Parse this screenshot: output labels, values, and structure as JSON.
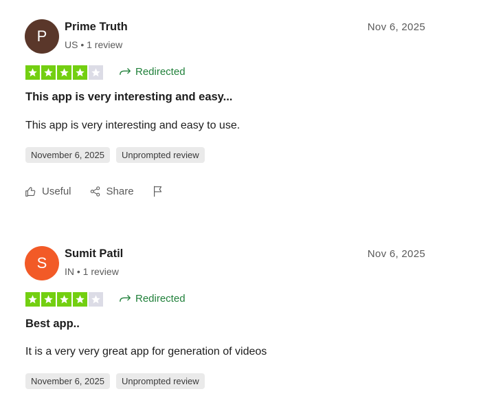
{
  "reviews": [
    {
      "avatar_letter": "P",
      "avatar_color": "#5a372a",
      "name": "Prime Truth",
      "meta": "US • 1 review",
      "date_short": "Nov 6, 2025",
      "rating": 4,
      "redirected_label": "Redirected",
      "title": "This app is very interesting and easy...",
      "text": "This app is very interesting and easy to use.",
      "date_tag": "November 6, 2025",
      "type_tag": "Unprompted review",
      "useful_label": "Useful",
      "share_label": "Share"
    },
    {
      "avatar_letter": "S",
      "avatar_color": "#f25a27",
      "name": "Sumit Patil",
      "meta": "IN • 1 review",
      "date_short": "Nov 6, 2025",
      "rating": 4,
      "redirected_label": "Redirected",
      "title": "Best app..",
      "text": "It is a very very great app for generation of videos",
      "date_tag": "November 6, 2025",
      "type_tag": "Unprompted review"
    }
  ],
  "colors": {
    "star_filled": "#73cf11",
    "star_empty": "#dcdce6",
    "redirected": "#20803a"
  },
  "icons": [
    "star-icon",
    "redirect-arrow-icon",
    "thumbs-up-icon",
    "share-icon",
    "flag-icon"
  ]
}
